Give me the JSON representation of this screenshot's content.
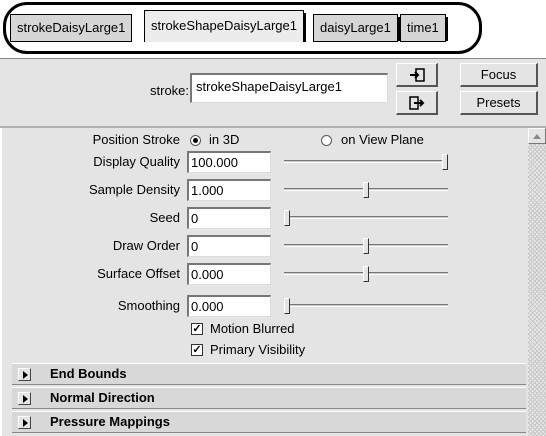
{
  "tabs": [
    {
      "label": "strokeDaisyLarge1",
      "active": false
    },
    {
      "label": "strokeShapeDaisyLarge1",
      "active": true
    },
    {
      "label": "daisyLarge1",
      "active": false
    },
    {
      "label": "time1",
      "active": false
    }
  ],
  "header": {
    "stroke_label": "stroke:",
    "stroke_value": "strokeShapeDaisyLarge1",
    "focus_label": "Focus",
    "presets_label": "Presets"
  },
  "position_stroke": {
    "label": "Position Stroke",
    "option_3d": "in 3D",
    "option_view_plane": "on View Plane",
    "selected": "in 3D"
  },
  "attributes": [
    {
      "label": "Display Quality",
      "value": "100.000",
      "slider_fraction": 1.0
    },
    {
      "label": "Sample Density",
      "value": "1.000",
      "slider_fraction": 0.5
    },
    {
      "label": "Seed",
      "value": "0",
      "slider_fraction": 0.0
    },
    {
      "label": "Draw Order",
      "value": "0",
      "slider_fraction": 0.5
    },
    {
      "label": "Surface Offset",
      "value": "0.000",
      "slider_fraction": 0.5
    },
    {
      "label": "Smoothing",
      "value": "0.000",
      "slider_fraction": 0.0
    }
  ],
  "checkboxes": [
    {
      "label": "Motion Blurred",
      "checked": true
    },
    {
      "label": "Primary Visibility",
      "checked": true
    }
  ],
  "sections": [
    {
      "title": "End Bounds"
    },
    {
      "title": "Normal Direction"
    },
    {
      "title": "Pressure Mappings"
    }
  ]
}
